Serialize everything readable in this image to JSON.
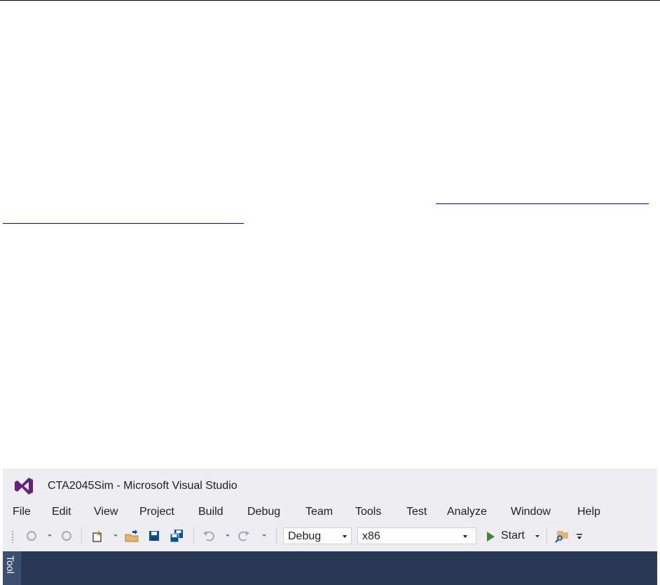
{
  "window": {
    "title": "CTA2045Sim - Microsoft Visual Studio"
  },
  "menu": {
    "items": [
      {
        "label": "File"
      },
      {
        "label": "Edit"
      },
      {
        "label": "View"
      },
      {
        "label": "Project"
      },
      {
        "label": "Build"
      },
      {
        "label": "Debug"
      },
      {
        "label": "Team"
      },
      {
        "label": "Tools"
      },
      {
        "label": "Test"
      },
      {
        "label": "Analyze"
      },
      {
        "label": "Window"
      },
      {
        "label": "Help"
      }
    ]
  },
  "toolbar": {
    "configuration": "Debug",
    "platform": "x86",
    "start_label": "Start"
  },
  "side_panel": {
    "toolbox_label": "Tool"
  },
  "icons": {
    "logo": "visual-studio-logo-icon",
    "back": "back-icon",
    "forward": "forward-icon",
    "new_project": "new-project-icon",
    "open_folder": "open-folder-icon",
    "save": "save-icon",
    "save_all": "save-all-icon",
    "undo": "undo-icon",
    "redo": "redo-icon",
    "start": "play-icon",
    "find": "find-in-files-icon",
    "overflow": "toolbar-overflow-icon"
  },
  "colors": {
    "chrome": "#eeeef2",
    "dark_panel": "#293955",
    "vs_purple": "#68217a",
    "start_green": "#388a34",
    "link": "#0000ff"
  }
}
